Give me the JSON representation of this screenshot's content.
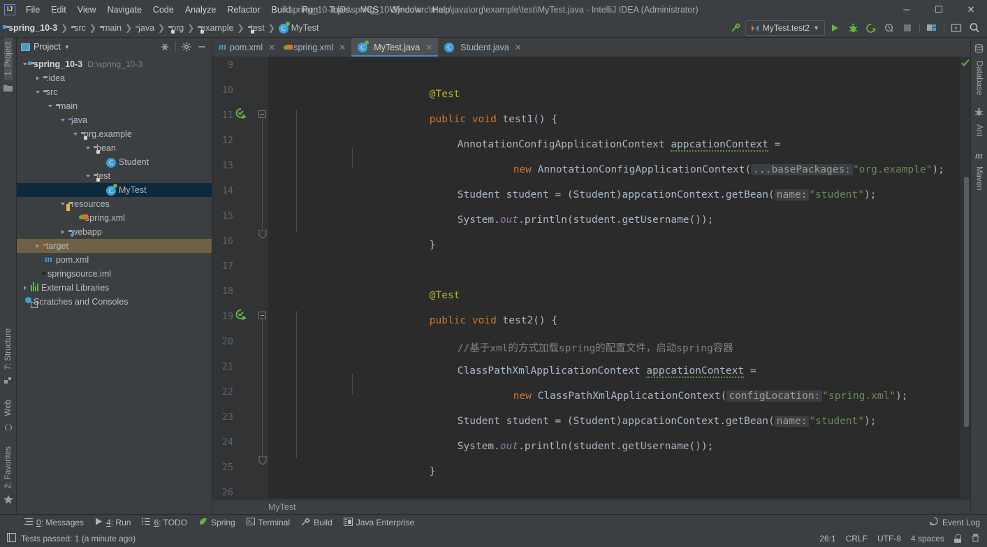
{
  "window": {
    "title": "spring_10-3 [D:\\spring_10-3] - ...\\src\\main\\java\\org\\example\\test\\MyTest.java - IntelliJ IDEA (Administrator)",
    "logo": "IJ",
    "minimize": "─",
    "maximize": "☐",
    "close": "✕"
  },
  "menu": [
    {
      "label": "File"
    },
    {
      "label": "Edit"
    },
    {
      "label": "View"
    },
    {
      "label": "Navigate"
    },
    {
      "label": "Code"
    },
    {
      "label": "Analyze"
    },
    {
      "label": "Refactor"
    },
    {
      "label": "Build"
    },
    {
      "label": "Run"
    },
    {
      "label": "Tools"
    },
    {
      "label": "VCS"
    },
    {
      "label": "Window"
    },
    {
      "label": "Help"
    }
  ],
  "breadcrumb": [
    {
      "label": "spring_10-3",
      "icon": "module-folder-icon"
    },
    {
      "label": "src",
      "icon": "folder-icon"
    },
    {
      "label": "main",
      "icon": "folder-icon"
    },
    {
      "label": "java",
      "icon": "source-folder-icon"
    },
    {
      "label": "org",
      "icon": "package-icon"
    },
    {
      "label": "example",
      "icon": "package-icon"
    },
    {
      "label": "test",
      "icon": "package-icon"
    },
    {
      "label": "MyTest",
      "icon": "test-class-icon"
    }
  ],
  "toolbar": {
    "build_label": "Build",
    "run_config": "MyTest.test2",
    "run_label": "Run",
    "debug_label": "Debug",
    "run_coverage_label": "Run with Coverage",
    "profiler_label": "Profiler",
    "stop_label": "Stop",
    "project_structure_label": "Project Structure",
    "updates_label": "Updates",
    "search_label": "Search Everywhere"
  },
  "left_strip": {
    "top": [
      {
        "label": "1: Project",
        "active": true
      }
    ],
    "bottom": [
      {
        "label": "2: Favorites"
      },
      {
        "label": "Web"
      },
      {
        "label": "7: Structure"
      }
    ]
  },
  "right_strip": [
    {
      "label": "Database"
    },
    {
      "label": "Ant"
    },
    {
      "label": "Maven"
    }
  ],
  "project_panel": {
    "title": "Project",
    "collapse_all_label": "Collapse All",
    "settings_label": "Settings",
    "hide_label": "Hide",
    "tree": [
      {
        "indent": 0,
        "arrow": "open",
        "icon": "module-folder-icon",
        "label": "spring_10-3",
        "path": "D:\\spring_10-3",
        "bold": true
      },
      {
        "indent": 1,
        "arrow": "closed",
        "icon": "folder-icon",
        "label": ".idea",
        "path": ""
      },
      {
        "indent": 1,
        "arrow": "open",
        "icon": "folder-icon",
        "label": "src",
        "path": ""
      },
      {
        "indent": 2,
        "arrow": "open",
        "icon": "folder-icon",
        "label": "main",
        "path": ""
      },
      {
        "indent": 3,
        "arrow": "open",
        "icon": "source-folder-icon",
        "label": "java",
        "path": ""
      },
      {
        "indent": 4,
        "arrow": "open",
        "icon": "package-icon",
        "label": "org.example",
        "path": ""
      },
      {
        "indent": 5,
        "arrow": "open",
        "icon": "package-icon",
        "label": "bean",
        "path": ""
      },
      {
        "indent": 6,
        "arrow": "none",
        "icon": "class-icon",
        "label": "Student",
        "path": ""
      },
      {
        "indent": 5,
        "arrow": "open",
        "icon": "package-icon",
        "label": "test",
        "path": ""
      },
      {
        "indent": 6,
        "arrow": "none",
        "icon": "test-class-icon",
        "label": "MyTest",
        "path": "",
        "selected": true
      },
      {
        "indent": 3,
        "arrow": "open",
        "icon": "resources-folder-icon",
        "label": "resources",
        "path": ""
      },
      {
        "indent": 4,
        "arrow": "none",
        "icon": "spring-xml-icon",
        "label": "spring.xml",
        "path": ""
      },
      {
        "indent": 3,
        "arrow": "closed",
        "icon": "webapp-folder-icon",
        "label": "webapp",
        "path": ""
      },
      {
        "indent": 1,
        "arrow": "closed",
        "icon": "target-folder-icon",
        "label": "target",
        "path": "",
        "highlight": true
      },
      {
        "indent": 2,
        "arrow": "none",
        "icon": "maven-icon",
        "label": "pom.xml",
        "path": ""
      },
      {
        "indent": 2,
        "arrow": "none",
        "icon": "iml-icon",
        "label": "springsource.iml",
        "path": ""
      },
      {
        "indent": 0,
        "arrow": "closed",
        "icon": "library-icon",
        "label": "External Libraries",
        "path": ""
      },
      {
        "indent": 0,
        "arrow": "none",
        "icon": "scratch-icon",
        "label": "Scratches and Consoles",
        "path": ""
      }
    ]
  },
  "editor": {
    "tabs": [
      {
        "label": "pom.xml",
        "icon": "maven-icon",
        "active": false,
        "close": "✕"
      },
      {
        "label": "spring.xml",
        "icon": "spring-xml-icon",
        "active": false,
        "close": "✕"
      },
      {
        "label": "MyTest.java",
        "icon": "test-class-icon",
        "active": true,
        "close": "✕"
      },
      {
        "label": "Student.java",
        "icon": "class-icon",
        "active": false,
        "close": "✕"
      }
    ],
    "line_numbers": [
      "9",
      "10",
      "11",
      "12",
      "13",
      "14",
      "15",
      "16",
      "17",
      "18",
      "19",
      "20",
      "21",
      "22",
      "23",
      "24",
      "25",
      "26"
    ],
    "breadcrumb": "MyTest",
    "code": {
      "l10_annotation": "@Test",
      "l11_kw1": "public",
      "l11_kw2": "void",
      "l11_name": "test1",
      "l11_tail": "() {",
      "l12_type": "AnnotationConfigApplicationContext",
      "l12_var": "appcationContext",
      "l12_eq": "=",
      "l13_new": "new",
      "l13_ctor": "AnnotationConfigApplicationContext",
      "l13_paren_open": "(",
      "l13_hint": "...basePackages:",
      "l13_str": "\"org.example\"",
      "l13_tail": ");",
      "l14_type": "Student",
      "l14_var": "student",
      "l14_eq": "=",
      "l14_cast": "(Student)",
      "l14_obj": "appcationContext",
      "l14_dot": ".",
      "l14_call": "getBean",
      "l14_paren": "(",
      "l14_hint": "name:",
      "l14_str": "\"student\"",
      "l14_tail": ");",
      "l15_sys": "System",
      "l15_out": "out",
      "l15_println": "println",
      "l15_arg": "(student.getUsername());",
      "l16_close": "}",
      "l18_annotation": "@Test",
      "l19_kw1": "public",
      "l19_kw2": "void",
      "l19_name": "test2",
      "l19_tail": "() {",
      "l20_comment": "//基于xml的方式加载spring的配置文件，启动spring容器",
      "l21_type": "ClassPathXmlApplicationContext",
      "l21_var": "appcationContext",
      "l21_eq": "=",
      "l22_new": "new",
      "l22_ctor": "ClassPathXmlApplicationContext",
      "l22_paren_open": "(",
      "l22_hint": "configLocation:",
      "l22_str": "\"spring.xml\"",
      "l22_tail": ");",
      "l23_type": "Student",
      "l23_var": "student",
      "l23_eq": "=",
      "l23_cast": "(Student)",
      "l23_obj": "appcationContext",
      "l23_dot": ".",
      "l23_call": "getBean",
      "l23_paren": "(",
      "l23_hint": "name:",
      "l23_str": "\"student\"",
      "l23_tail": ");",
      "l24_sys": "System",
      "l24_out": "out",
      "l24_println": "println",
      "l24_arg": "(student.getUsername());",
      "l25_close": "}"
    }
  },
  "tool_windows": [
    {
      "num": "0",
      "label": "Messages",
      "icon": "messages-icon"
    },
    {
      "num": "4",
      "label": "Run",
      "icon": "run-icon"
    },
    {
      "num": "6",
      "label": "TODO",
      "icon": "todo-icon"
    },
    {
      "num": "",
      "label": "Spring",
      "icon": "spring-icon"
    },
    {
      "num": "",
      "label": "Terminal",
      "icon": "terminal-icon"
    },
    {
      "num": "",
      "label": "Build",
      "icon": "build-icon"
    },
    {
      "num": "",
      "label": "Java Enterprise",
      "icon": "java-enterprise-icon"
    }
  ],
  "event_log": "Event Log",
  "status": {
    "message": "Tests passed: 1 (a minute ago)",
    "caret": "26:1",
    "line_sep": "CRLF",
    "encoding": "UTF-8",
    "indent": "4 spaces",
    "lock": "read-write-lock-icon",
    "inspector": "inspection-icon"
  },
  "colors": {
    "accent": "#4a88c7",
    "selection": "#0d293e",
    "target_highlight": "#6e6145",
    "string": "#6a8759",
    "keyword": "#cc7832",
    "annotation": "#bbb529",
    "comment": "#808080",
    "static_field": "#9876aa",
    "green_run": "#62b543",
    "panel_bg": "#3c3f41",
    "editor_bg": "#2b2b2b",
    "gutter_bg": "#313335"
  }
}
